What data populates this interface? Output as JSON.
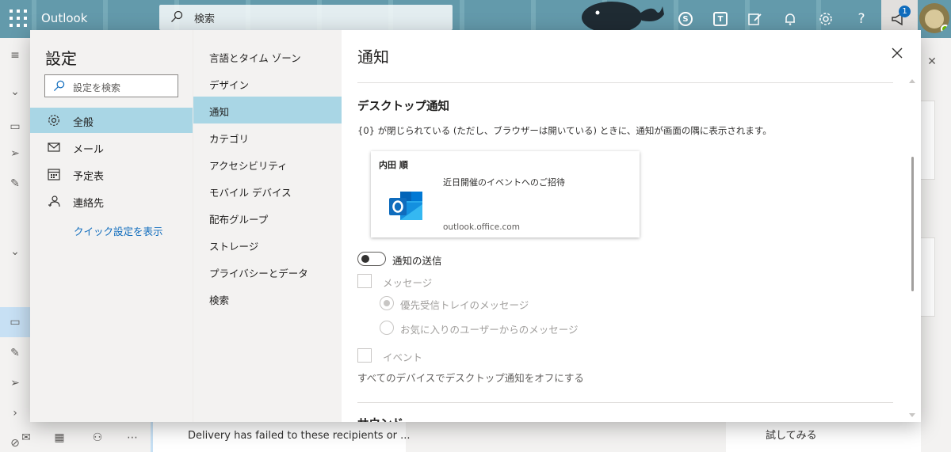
{
  "topbar": {
    "app_name": "Outlook",
    "search_placeholder": "検索",
    "notification_badge": "1",
    "icons": [
      "waffle-icon",
      "skype-icon",
      "teams-icon",
      "compose-note-icon",
      "bell-icon",
      "gear-icon",
      "help-icon",
      "megaphone-icon"
    ]
  },
  "background": {
    "mail_preview_line1": "",
    "mail_preview_line2": "Delivery has failed to these recipients or ...",
    "try_button": "試してみる"
  },
  "settings": {
    "title": "設定",
    "search_placeholder": "設定を検索",
    "categories": [
      {
        "label": "全般",
        "icon": "gear-icon",
        "active": true
      },
      {
        "label": "メール",
        "icon": "mail-icon",
        "active": false
      },
      {
        "label": "予定表",
        "icon": "calendar-icon",
        "active": false
      },
      {
        "label": "連絡先",
        "icon": "people-icon",
        "active": false
      }
    ],
    "quick_settings_link": "クイック設定を表示",
    "subcategories": [
      {
        "label": "言語とタイム ゾーン",
        "active": false
      },
      {
        "label": "デザイン",
        "active": false
      },
      {
        "label": "通知",
        "active": true
      },
      {
        "label": "カテゴリ",
        "active": false
      },
      {
        "label": "アクセシビリティ",
        "active": false
      },
      {
        "label": "モバイル デバイス",
        "active": false
      },
      {
        "label": "配布グループ",
        "active": false
      },
      {
        "label": "ストレージ",
        "active": false
      },
      {
        "label": "プライバシーとデータ",
        "active": false
      },
      {
        "label": "検索",
        "active": false
      }
    ]
  },
  "pane": {
    "title": "通知",
    "section_title": "デスクトップ通知",
    "section_desc": "{0} が閉じられている (ただし、ブラウザーは開いている) ときに、通知が画面の隅に表示されます。",
    "preview": {
      "sender": "内田 順",
      "subject": "近日開催のイベントへのご招待",
      "domain": "outlook.office.com"
    },
    "toggle_label": "通知の送信",
    "toggle_on": false,
    "messages_label": "メッセージ",
    "radio_focused": "優先受信トレイのメッセージ",
    "radio_favorites": "お気に入りのユーザーからのメッセージ",
    "events_label": "イベント",
    "turn_off_all": "すべてのデバイスでデスクトップ通知をオフにする",
    "next_section_partial": "サウンド"
  },
  "colors": {
    "accent": "#0f6cbd",
    "selected_bg": "#a9d6e5",
    "topbar": "#5b8ea0"
  }
}
